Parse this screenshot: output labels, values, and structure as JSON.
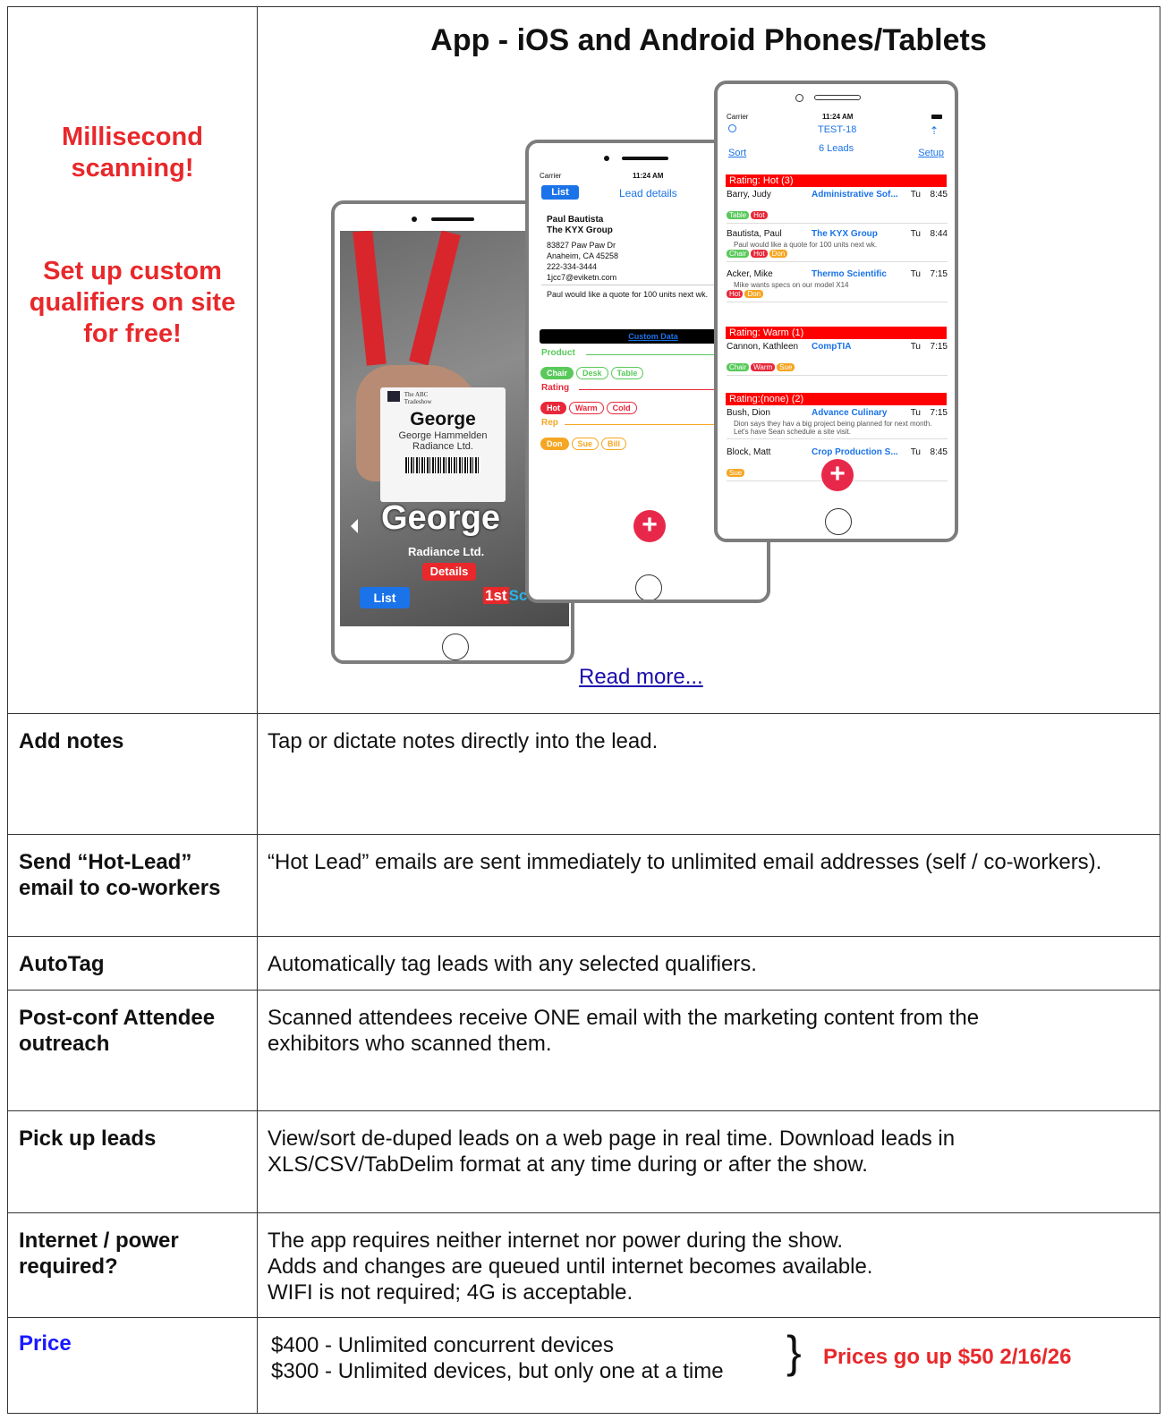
{
  "hero": {
    "title": "App - iOS and Android Phones/Tablets",
    "left_line1": "Millisecond",
    "left_line2": "scanning!",
    "left_line3": "Set up custom",
    "left_line4": "qualifiers on site",
    "left_line5": "for free!",
    "read_more": "Read more..."
  },
  "phone1": {
    "badge_show_line1": "The ABC",
    "badge_show_line2": "Tradeshow",
    "badge_first": "George",
    "badge_name": "George Hammelden",
    "badge_company": "Radiance Ltd.",
    "big_name": "George",
    "big_company": "Radiance Ltd.",
    "details_label": "Details",
    "list_label": "List",
    "logo_text": "1st",
    "logo_suffix": "Sc"
  },
  "phone2": {
    "carrier": "Carrier",
    "time": "11:24 AM",
    "list_label": "List",
    "title": "Lead details",
    "name": "Paul Bautista",
    "company": "The KYX Group",
    "addr1": "83827 Paw Paw Dr",
    "addr2": "Anaheim, CA 45258",
    "phone": "222-334-3444",
    "email": "1jcc7@eviketn.com",
    "note": "Paul would like a quote for 100 units next wk.",
    "custom_data": "Custom Data",
    "product_label": "Product",
    "product_options": [
      "Chair",
      "Desk",
      "Table"
    ],
    "rating_label": "Rating",
    "rating_options": [
      "Hot",
      "Warm",
      "Cold"
    ],
    "rep_label": "Rep",
    "rep_options": [
      "Don",
      "Sue",
      "Bill"
    ],
    "fab": "+"
  },
  "phone3": {
    "carrier": "Carrier",
    "time": "11:24 AM",
    "event": "TEST-18",
    "count": "6 Leads",
    "sort": "Sort",
    "setup": "Setup",
    "sec_hot": "Rating: Hot (3)",
    "sec_warm": "Rating: Warm (1)",
    "sec_none": "Rating:(none) (2)",
    "leads": [
      {
        "name": "Barry, Judy",
        "company": "Administrative Sof...",
        "day": "Tu",
        "time": "8:45",
        "note": "",
        "tags": [
          "Table",
          "Hot"
        ]
      },
      {
        "name": "Bautista, Paul",
        "company": "The KYX Group",
        "day": "Tu",
        "time": "8:44",
        "note": "Paul would like a quote for 100 units next wk.",
        "tags": [
          "Chair",
          "Hot",
          "Don"
        ]
      },
      {
        "name": "Acker, Mike",
        "company": "Thermo Scientific",
        "day": "Tu",
        "time": "7:15",
        "note": "Mike wants specs on our model X14",
        "tags": [
          "Hot",
          "Don"
        ]
      },
      {
        "name": "Cannon, Kathleen",
        "company": "CompTIA",
        "day": "Tu",
        "time": "7:15",
        "note": "",
        "tags": [
          "Chair",
          "Warm",
          "Sue"
        ]
      },
      {
        "name": "Bush, Dion",
        "company": "Advance Culinary",
        "day": "Tu",
        "time": "7:15",
        "note": "Dion says they hav a big project being planned for next month. Let's have Sean schedule a site visit.",
        "tags": []
      },
      {
        "name": "Block, Matt",
        "company": "Crop Production S...",
        "day": "Tu",
        "time": "8:45",
        "note": "",
        "tags": [
          "Sue"
        ]
      }
    ],
    "fab": "+"
  },
  "rows": [
    {
      "label": "Add notes",
      "desc": "Tap or dictate notes directly into the lead."
    },
    {
      "label": "Send “Hot-Lead” email to co-workers",
      "desc": "“Hot Lead” emails are sent immediately to unlimited email addresses (self / co-workers)."
    },
    {
      "label": "AutoTag",
      "desc": "Automatically tag leads with any selected qualifiers."
    },
    {
      "label": "Post-conf Attendee outreach",
      "desc": "Scanned attendees receive ONE email with the marketing content from the exhibitors who scanned them."
    },
    {
      "label": "Pick up leads",
      "desc": "View/sort de-duped leads on a web page in real time. Download leads in XLS/CSV/TabDelim format at any time during or after the show."
    },
    {
      "label": "Internet / power required?",
      "desc_line1": "The app requires neither internet nor power during the show.",
      "desc_line2": "Adds and changes are queued until internet becomes available.",
      "desc_line3": "WIFI is not required; 4G is acceptable."
    }
  ],
  "price": {
    "label": "Price",
    "line1": "$400 - Unlimited concurrent devices",
    "line2": "$300 - Unlimited devices, but only one at a time",
    "brace": "}",
    "note": "Prices go up $50 2/16/26"
  },
  "colors": {
    "red": "#e8282b",
    "blue_link": "#1a0dab",
    "price_blue": "#1a1aff",
    "ios_blue": "#1a73e8",
    "tag_green": "#58c95a",
    "tag_red": "#e8283a",
    "tag_orange": "#f5a623"
  }
}
